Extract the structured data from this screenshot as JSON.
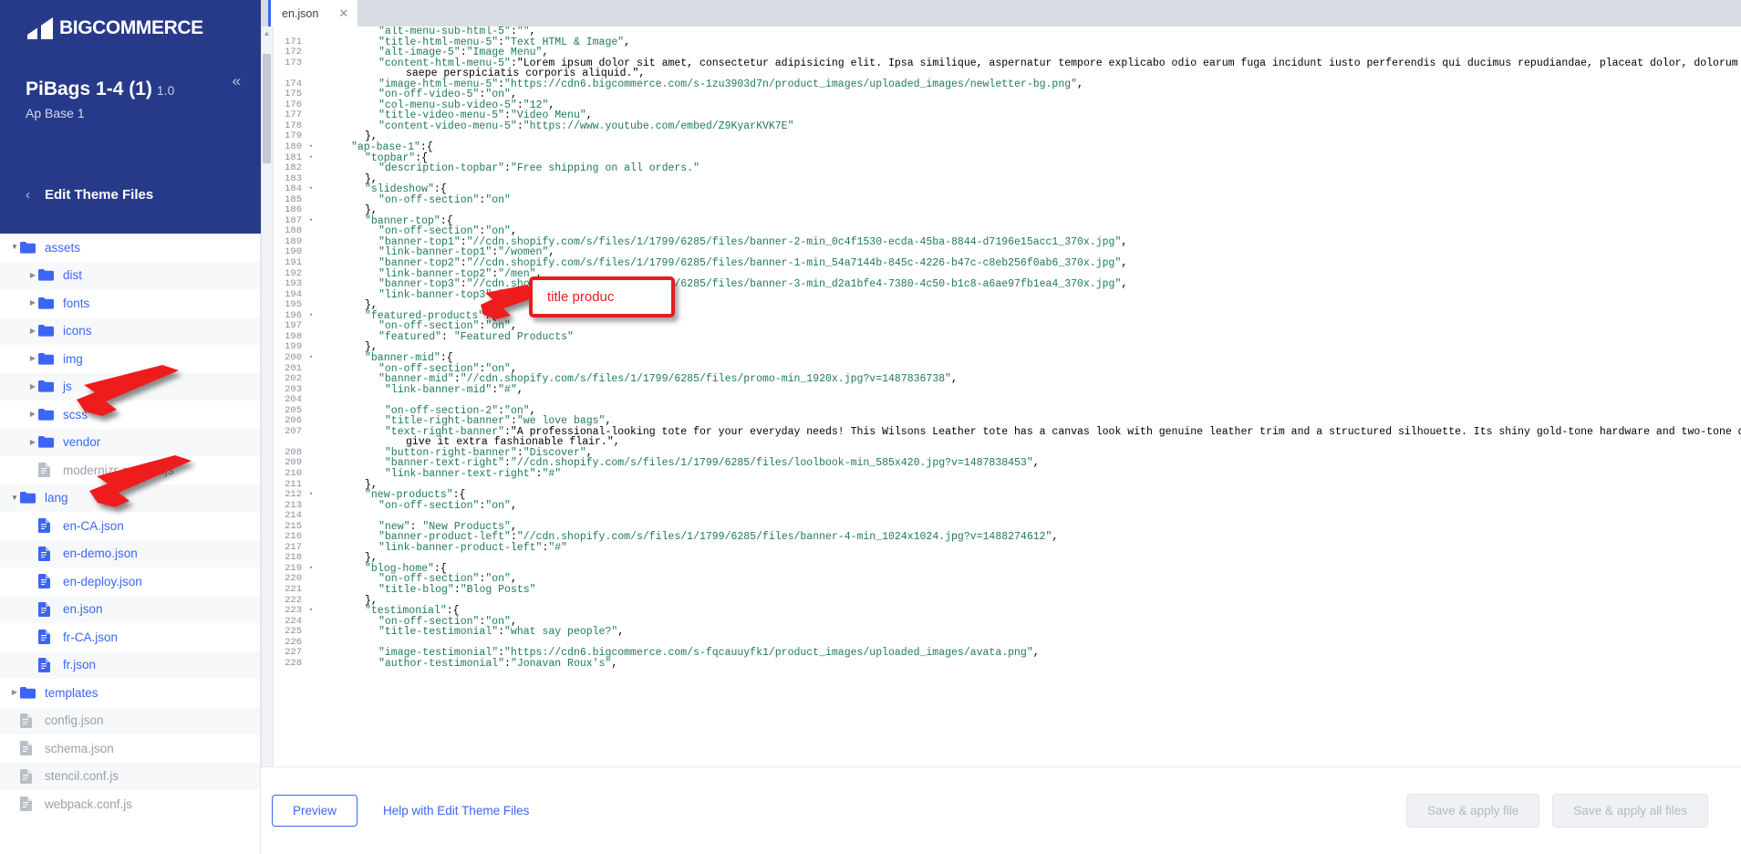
{
  "brand": {
    "name": "BIGCOMMERCE",
    "logo_icon": "bigcommerce-logo-icon"
  },
  "sidebar": {
    "theme_name": "PiBags 1-4 (1)",
    "theme_version": "1.0",
    "theme_variation": "Ap Base 1",
    "collapse_icon": "chevron-double-left-icon",
    "back_icon": "chevron-left-icon",
    "section_label": "Edit Theme Files",
    "tree": [
      {
        "label": "assets",
        "type": "folder",
        "depth": 0,
        "state": "open",
        "shade": false,
        "dim": false
      },
      {
        "label": "dist",
        "type": "folder",
        "depth": 1,
        "state": "closed",
        "shade": true,
        "dim": false
      },
      {
        "label": "fonts",
        "type": "folder",
        "depth": 1,
        "state": "closed",
        "shade": false,
        "dim": false
      },
      {
        "label": "icons",
        "type": "folder",
        "depth": 1,
        "state": "closed",
        "shade": true,
        "dim": false
      },
      {
        "label": "img",
        "type": "folder",
        "depth": 1,
        "state": "closed",
        "shade": false,
        "dim": false
      },
      {
        "label": "js",
        "type": "folder",
        "depth": 1,
        "state": "closed",
        "shade": true,
        "dim": false
      },
      {
        "label": "scss",
        "type": "folder",
        "depth": 1,
        "state": "closed",
        "shade": false,
        "dim": false
      },
      {
        "label": "vendor",
        "type": "folder",
        "depth": 1,
        "state": "closed",
        "shade": true,
        "dim": false
      },
      {
        "label": "modernizr-custom.js",
        "type": "file",
        "depth": 1,
        "state": "none",
        "shade": false,
        "dim": true
      },
      {
        "label": "lang",
        "type": "folder",
        "depth": 0,
        "state": "open",
        "shade": true,
        "dim": false
      },
      {
        "label": "en-CA.json",
        "type": "file",
        "depth": 1,
        "state": "none",
        "shade": false,
        "dim": false
      },
      {
        "label": "en-demo.json",
        "type": "file",
        "depth": 1,
        "state": "none",
        "shade": true,
        "dim": false
      },
      {
        "label": "en-deploy.json",
        "type": "file",
        "depth": 1,
        "state": "none",
        "shade": false,
        "dim": false
      },
      {
        "label": "en.json",
        "type": "file",
        "depth": 1,
        "state": "none",
        "shade": true,
        "dim": false
      },
      {
        "label": "fr-CA.json",
        "type": "file",
        "depth": 1,
        "state": "none",
        "shade": false,
        "dim": false
      },
      {
        "label": "fr.json",
        "type": "file",
        "depth": 1,
        "state": "none",
        "shade": true,
        "dim": false
      },
      {
        "label": "templates",
        "type": "folder",
        "depth": 0,
        "state": "closed",
        "shade": false,
        "dim": false
      },
      {
        "label": "config.json",
        "type": "file",
        "depth": 0,
        "state": "none",
        "shade": true,
        "dim": true
      },
      {
        "label": "schema.json",
        "type": "file",
        "depth": 0,
        "state": "none",
        "shade": false,
        "dim": true
      },
      {
        "label": "stencil.conf.js",
        "type": "file",
        "depth": 0,
        "state": "none",
        "shade": true,
        "dim": true
      },
      {
        "label": "webpack.conf.js",
        "type": "file",
        "depth": 0,
        "state": "none",
        "shade": false,
        "dim": true
      }
    ]
  },
  "editor": {
    "tab_label": "en.json",
    "tab_close_icon": "close-icon",
    "scroll_up_icon": "caret-up-icon",
    "first_visible_line": 171,
    "lines": [
      {
        "n": "",
        "fold": "",
        "indent": 8,
        "text": "\"alt-menu-sub-html-5\":\"\",",
        "partial": true
      },
      {
        "n": "171",
        "fold": "",
        "indent": 8,
        "text": "\"title-html-menu-5\":\"Text HTML & Image\","
      },
      {
        "n": "172",
        "fold": "",
        "indent": 8,
        "text": "\"alt-image-5\":\"Image Menu\","
      },
      {
        "n": "173",
        "fold": "",
        "indent": 8,
        "text": "\"content-html-menu-5\":\"Lorem ipsum dolor sit amet, consectetur adipisicing elit. Ipsa similique, aspernatur tempore explicabo odio earum fuga incidunt iusto perferendis qui ducimus repudiandae, placeat dolor, dolorum veritatis"
      },
      {
        "n": "",
        "fold": "",
        "indent": 12,
        "text": "saepe perspiciatis corporis aliquid.\","
      },
      {
        "n": "174",
        "fold": "",
        "indent": 8,
        "text": "\"image-html-menu-5\":\"https://cdn6.bigcommerce.com/s-1zu3903d7n/product_images/uploaded_images/newletter-bg.png\","
      },
      {
        "n": "175",
        "fold": "",
        "indent": 8,
        "text": "\"on-off-video-5\":\"on\","
      },
      {
        "n": "176",
        "fold": "",
        "indent": 8,
        "text": "\"col-menu-sub-video-5\":\"12\","
      },
      {
        "n": "177",
        "fold": "",
        "indent": 8,
        "text": "\"title-video-menu-5\":\"Video Menu\","
      },
      {
        "n": "178",
        "fold": "",
        "indent": 8,
        "text": "\"content-video-menu-5\":\"https://www.youtube.com/embed/Z9KyarKVK7E\""
      },
      {
        "n": "179",
        "fold": "",
        "indent": 6,
        "text": "},"
      },
      {
        "n": "180",
        "fold": "▾",
        "indent": 4,
        "text": "\"ap-base-1\":{"
      },
      {
        "n": "181",
        "fold": "▾",
        "indent": 6,
        "text": "\"topbar\":{"
      },
      {
        "n": "182",
        "fold": "",
        "indent": 8,
        "text": "\"description-topbar\":\"Free shipping on all orders.\""
      },
      {
        "n": "183",
        "fold": "",
        "indent": 6,
        "text": "},"
      },
      {
        "n": "184",
        "fold": "▾",
        "indent": 6,
        "text": "\"slideshow\":{"
      },
      {
        "n": "185",
        "fold": "",
        "indent": 8,
        "text": "\"on-off-section\":\"on\""
      },
      {
        "n": "186",
        "fold": "",
        "indent": 6,
        "text": "},"
      },
      {
        "n": "187",
        "fold": "▾",
        "indent": 6,
        "text": "\"banner-top\":{"
      },
      {
        "n": "188",
        "fold": "",
        "indent": 8,
        "text": "\"on-off-section\":\"on\","
      },
      {
        "n": "189",
        "fold": "",
        "indent": 8,
        "text": "\"banner-top1\":\"//cdn.shopify.com/s/files/1/1799/6285/files/banner-2-min_0c4f1530-ecda-45ba-8844-d7196e15acc1_370x.jpg\","
      },
      {
        "n": "190",
        "fold": "",
        "indent": 8,
        "text": "\"link-banner-top1\":\"/women\","
      },
      {
        "n": "191",
        "fold": "",
        "indent": 8,
        "text": "\"banner-top2\":\"//cdn.shopify.com/s/files/1/1799/6285/files/banner-1-min_54a7144b-845c-4226-b47c-c8eb256f0ab6_370x.jpg\","
      },
      {
        "n": "192",
        "fold": "",
        "indent": 8,
        "text": "\"link-banner-top2\":\"/men\","
      },
      {
        "n": "193",
        "fold": "",
        "indent": 8,
        "text": "\"banner-top3\":\"//cdn.shopify.com/s/files/1/1799/6285/files/banner-3-min_d2a1bfe4-7380-4c50-b1c8-a6ae97fb1ea4_370x.jpg\","
      },
      {
        "n": "194",
        "fold": "",
        "indent": 8,
        "text": "\"link-banner-top3\":\"/shop\""
      },
      {
        "n": "195",
        "fold": "",
        "indent": 6,
        "text": "},"
      },
      {
        "n": "196",
        "fold": "▾",
        "indent": 6,
        "text": "\"featured-products\":{"
      },
      {
        "n": "197",
        "fold": "",
        "indent": 8,
        "text": "\"on-off-section\":\"on\","
      },
      {
        "n": "198",
        "fold": "",
        "indent": 8,
        "text": "\"featured\": \"Featured Products\""
      },
      {
        "n": "199",
        "fold": "",
        "indent": 6,
        "text": "},"
      },
      {
        "n": "200",
        "fold": "▾",
        "indent": 6,
        "text": "\"banner-mid\":{"
      },
      {
        "n": "201",
        "fold": "",
        "indent": 8,
        "text": "\"on-off-section\":\"on\","
      },
      {
        "n": "202",
        "fold": "",
        "indent": 8,
        "text": "\"banner-mid\":\"//cdn.shopify.com/s/files/1/1799/6285/files/promo-min_1920x.jpg?v=1487836738\","
      },
      {
        "n": "203",
        "fold": "",
        "indent": 8,
        "text": " \"link-banner-mid\":\"#\","
      },
      {
        "n": "204",
        "fold": "",
        "indent": 0,
        "text": ""
      },
      {
        "n": "205",
        "fold": "",
        "indent": 8,
        "text": " \"on-off-section-2\":\"on\","
      },
      {
        "n": "206",
        "fold": "",
        "indent": 8,
        "text": " \"title-right-banner\":\"we love bags\","
      },
      {
        "n": "207",
        "fold": "",
        "indent": 8,
        "text": " \"text-right-banner\":\"A professional-looking tote for your everyday needs! This Wilsons Leather tote has a canvas look with genuine leather trim and a structured silhouette. Its shiny gold-tone hardware and two-tone design"
      },
      {
        "n": "",
        "fold": "",
        "indent": 12,
        "text": "give it extra fashionable flair.\","
      },
      {
        "n": "208",
        "fold": "",
        "indent": 8,
        "text": " \"button-right-banner\":\"Discover\","
      },
      {
        "n": "209",
        "fold": "",
        "indent": 8,
        "text": " \"banner-text-right\":\"//cdn.shopify.com/s/files/1/1799/6285/files/loolbook-min_585x420.jpg?v=1487838453\","
      },
      {
        "n": "210",
        "fold": "",
        "indent": 8,
        "text": " \"link-banner-text-right\":\"#\""
      },
      {
        "n": "211",
        "fold": "",
        "indent": 6,
        "text": "},"
      },
      {
        "n": "212",
        "fold": "▾",
        "indent": 6,
        "text": "\"new-products\":{"
      },
      {
        "n": "213",
        "fold": "",
        "indent": 8,
        "text": "\"on-off-section\":\"on\","
      },
      {
        "n": "214",
        "fold": "",
        "indent": 0,
        "text": ""
      },
      {
        "n": "215",
        "fold": "",
        "indent": 8,
        "text": "\"new\": \"New Products\","
      },
      {
        "n": "216",
        "fold": "",
        "indent": 8,
        "text": "\"banner-product-left\":\"//cdn.shopify.com/s/files/1/1799/6285/files/banner-4-min_1024x1024.jpg?v=1488274612\","
      },
      {
        "n": "217",
        "fold": "",
        "indent": 8,
        "text": "\"link-banner-product-left\":\"#\""
      },
      {
        "n": "218",
        "fold": "",
        "indent": 6,
        "text": "},"
      },
      {
        "n": "219",
        "fold": "▾",
        "indent": 6,
        "text": "\"blog-home\":{"
      },
      {
        "n": "220",
        "fold": "",
        "indent": 8,
        "text": "\"on-off-section\":\"on\","
      },
      {
        "n": "221",
        "fold": "",
        "indent": 8,
        "text": "\"title-blog\":\"Blog Posts\""
      },
      {
        "n": "222",
        "fold": "",
        "indent": 6,
        "text": "},"
      },
      {
        "n": "223",
        "fold": "▾",
        "indent": 6,
        "text": "\"testimonial\":{"
      },
      {
        "n": "224",
        "fold": "",
        "indent": 8,
        "text": "\"on-off-section\":\"on\","
      },
      {
        "n": "225",
        "fold": "",
        "indent": 8,
        "text": "\"title-testimonial\":\"what say people?\","
      },
      {
        "n": "226",
        "fold": "",
        "indent": 0,
        "text": ""
      },
      {
        "n": "227",
        "fold": "",
        "indent": 8,
        "text": "\"image-testimonial\":\"https://cdn6.bigcommerce.com/s-fqcauuyfk1/product_images/uploaded_images/avata.png\","
      },
      {
        "n": "228",
        "fold": "",
        "indent": 8,
        "text": "\"author-testimonial\":\"Jonavan Roux's\","
      }
    ]
  },
  "footer": {
    "preview_label": "Preview",
    "help_label": "Help with Edit Theme Files",
    "save_apply_file_label": "Save & apply file",
    "save_apply_all_label": "Save & apply all files"
  },
  "annotations": {
    "callout_text": "title produc",
    "accent_color": "#e81c1c",
    "arrows": [
      {
        "name": "arrow-to-lang-folder"
      },
      {
        "name": "arrow-to-en-json"
      },
      {
        "name": "arrow-to-featured-line"
      }
    ]
  }
}
